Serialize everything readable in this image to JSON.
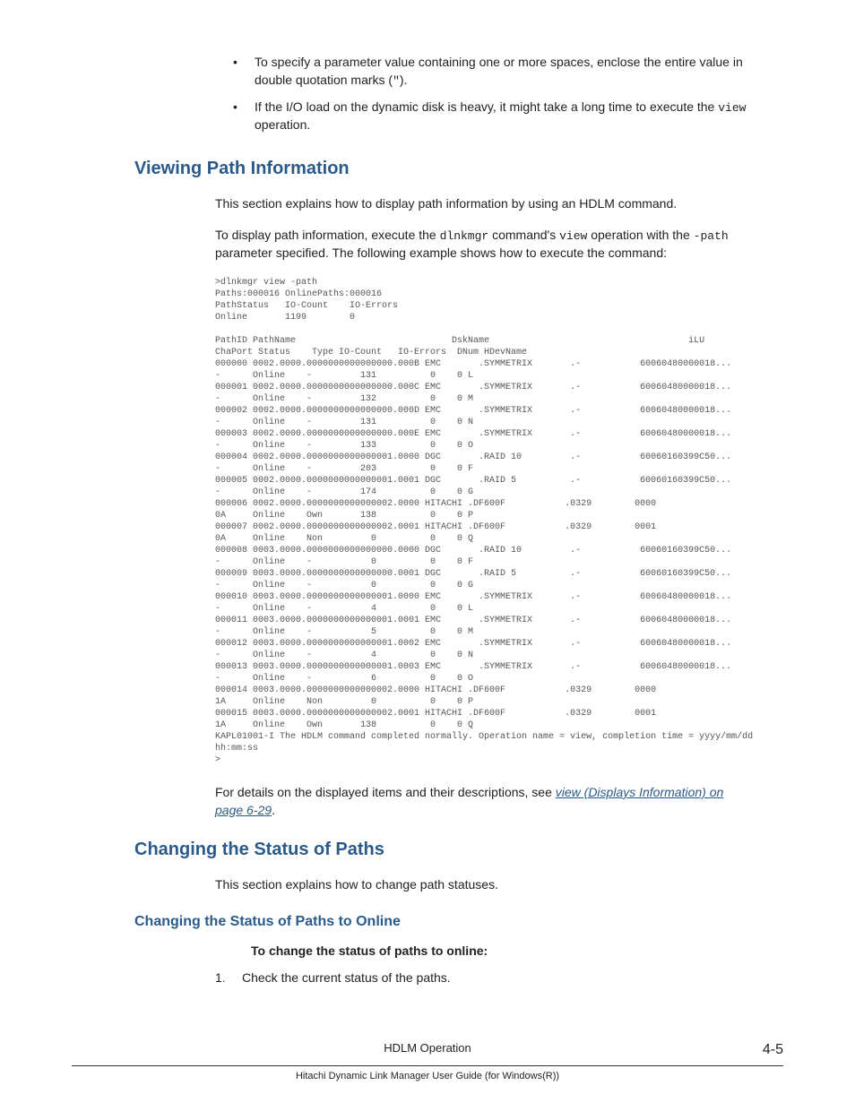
{
  "bullets": {
    "b1_pre": "To specify a parameter value containing one or more spaces, enclose the entire value in double quotation marks (",
    "b1_code": "\"",
    "b1_post": ").",
    "b2_pre": "If the I/O load on the dynamic disk is heavy, it might take a long time to execute the ",
    "b2_code": "view",
    "b2_post": " operation."
  },
  "h_viewing": "Viewing Path Information",
  "p_viewing_intro": "This section explains how to display path information by using an HDLM command.",
  "p_viewing_2a": "To display path information, execute the ",
  "p_viewing_code1": "dlnkmgr",
  "p_viewing_2b": " command's ",
  "p_viewing_code2": "view",
  "p_viewing_2c": " operation with the ",
  "p_viewing_code3": "-path",
  "p_viewing_2d": " parameter specified. The following example shows how to execute the command:",
  "code_block": ">dlnkmgr view -path\nPaths:000016 OnlinePaths:000016\nPathStatus   IO-Count    IO-Errors\nOnline       1199        0\n\nPathID PathName                             DskName                                     iLU\nChaPort Status    Type IO-Count   IO-Errors  DNum HDevName\n000000 0002.0000.0000000000000000.000B EMC       .SYMMETRIX       .-           60060480000018...\n-      Online    -         131          0    0 L\n000001 0002.0000.0000000000000000.000C EMC       .SYMMETRIX       .-           60060480000018...\n-      Online    -         132          0    0 M\n000002 0002.0000.0000000000000000.000D EMC       .SYMMETRIX       .-           60060480000018...\n-      Online    -         131          0    0 N\n000003 0002.0000.0000000000000000.000E EMC       .SYMMETRIX       .-           60060480000018...\n-      Online    -         133          0    0 O\n000004 0002.0000.0000000000000001.0000 DGC       .RAID 10         .-           60060160399C50...\n-      Online    -         203          0    0 F\n000005 0002.0000.0000000000000001.0001 DGC       .RAID 5          .-           60060160399C50...\n-      Online    -         174          0    0 G\n000006 0002.0000.0000000000000002.0000 HITACHI .DF600F           .0329        0000\n0A     Online    Own       138          0    0 P\n000007 0002.0000.0000000000000002.0001 HITACHI .DF600F           .0329        0001\n0A     Online    Non         0          0    0 Q\n000008 0003.0000.0000000000000000.0000 DGC       .RAID 10         .-           60060160399C50...\n-      Online    -           0          0    0 F\n000009 0003.0000.0000000000000000.0001 DGC       .RAID 5          .-           60060160399C50...\n-      Online    -           0          0    0 G\n000010 0003.0000.0000000000000001.0000 EMC       .SYMMETRIX       .-           60060480000018...\n-      Online    -           4          0    0 L\n000011 0003.0000.0000000000000001.0001 EMC       .SYMMETRIX       .-           60060480000018...\n-      Online    -           5          0    0 M\n000012 0003.0000.0000000000000001.0002 EMC       .SYMMETRIX       .-           60060480000018...\n-      Online    -           4          0    0 N\n000013 0003.0000.0000000000000001.0003 EMC       .SYMMETRIX       .-           60060480000018...\n-      Online    -           6          0    0 O\n000014 0003.0000.0000000000000002.0000 HITACHI .DF600F           .0329        0000\n1A     Online    Non         0          0    0 P\n000015 0003.0000.0000000000000002.0001 HITACHI .DF600F           .0329        0001\n1A     Online    Own       138          0    0 Q\nKAPL01001-I The HDLM command completed normally. Operation name = view, completion time = yyyy/mm/dd\nhh:mm:ss\n>",
  "p_details_pre": "For details on the displayed items and their descriptions, see ",
  "link_text": "view (Displays Information) on page 6-29",
  "p_details_post": ".",
  "h_changing": "Changing the Status of Paths",
  "p_changing_intro": "This section explains how to change path statuses.",
  "h_changing_online": "Changing the Status of Paths to Online",
  "subhead_online": "To change the status of paths to online:",
  "step1_num": "1",
  "step1_text": "Check the current status of the paths.",
  "footer_chapter": "HDLM Operation",
  "footer_page": "4-5",
  "footer_book": "Hitachi Dynamic Link Manager User Guide (for Windows(R))"
}
